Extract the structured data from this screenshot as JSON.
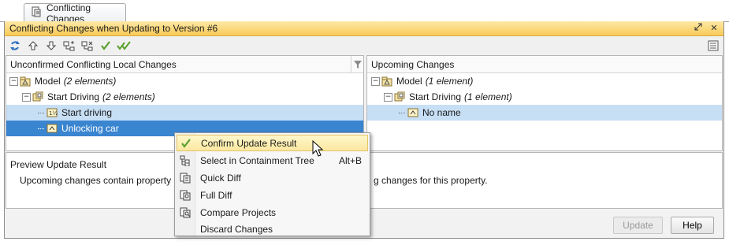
{
  "tab": {
    "label": "Conflicting Changes"
  },
  "panel": {
    "title": "Conflicting Changes when Updating to Version #6",
    "controls": [
      "restore-icon",
      "close-icon"
    ]
  },
  "toolbar": {
    "icons": [
      "refresh-icon",
      "arrow-up-icon",
      "arrow-down-icon",
      "expand-tree-icon",
      "collapse-tree-icon",
      "check-icon",
      "double-check-icon"
    ],
    "right_icon": "list-options-icon"
  },
  "left_pane": {
    "header": "Unconfirmed Conflicting Local Changes",
    "rows": [
      {
        "label": "Model",
        "detail": "(2 elements)"
      },
      {
        "label": "Start Driving",
        "detail": "(2 elements)"
      },
      {
        "label": "Start driving",
        "detail": ""
      },
      {
        "label": "Unlocking car",
        "detail": ""
      }
    ]
  },
  "right_pane": {
    "header": "Upcoming Changes",
    "rows": [
      {
        "label": "Model",
        "detail": "(1 element)"
      },
      {
        "label": "Start Driving",
        "detail": "(1 element)"
      },
      {
        "label": "No name",
        "detail": ""
      }
    ]
  },
  "preview": {
    "title": "Preview Update Result",
    "text": "Upcoming changes contain property \"Nar",
    "text_right": "g changes for this property."
  },
  "buttons": {
    "update": "Update",
    "help": "Help"
  },
  "context_menu": {
    "items": [
      {
        "label": "Confirm Update Result",
        "shortcut": "",
        "icon": "check-icon",
        "highlighted": true
      },
      {
        "label": "Select in Containment Tree",
        "shortcut": "Alt+B",
        "icon": "containment-tree-icon",
        "highlighted": false
      },
      {
        "label": "Quick Diff",
        "shortcut": "",
        "icon": "quick-diff-icon",
        "highlighted": false
      },
      {
        "label": "Full Diff",
        "shortcut": "",
        "icon": "full-diff-icon",
        "highlighted": false
      },
      {
        "label": "Compare Projects",
        "shortcut": "",
        "icon": "compare-projects-icon",
        "highlighted": false
      },
      {
        "label": "Discard Changes",
        "shortcut": "",
        "icon": "",
        "highlighted": false
      }
    ]
  },
  "colors": {
    "title_bar": "#f8ca58",
    "selection_dark": "#3a85d0",
    "selection_light": "#c7dff5",
    "menu_highlight": "#fbe8a0"
  }
}
